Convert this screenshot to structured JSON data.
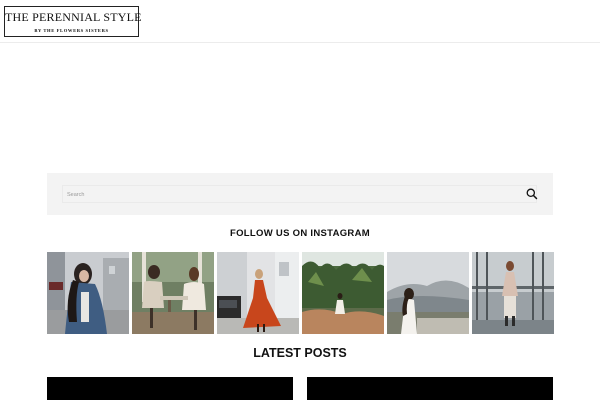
{
  "header": {
    "logo_title": "THE PERENNIAL STYLE",
    "logo_subtitle": "BY THE FLOWERS SISTERS"
  },
  "search": {
    "placeholder": "Search",
    "icon": "search-icon"
  },
  "instagram": {
    "heading": "FOLLOW US ON INSTAGRAM",
    "photos": [
      {
        "icon": "instagram-photo"
      },
      {
        "icon": "instagram-photo"
      },
      {
        "icon": "instagram-photo"
      },
      {
        "icon": "instagram-photo"
      },
      {
        "icon": "instagram-photo"
      },
      {
        "icon": "instagram-photo"
      }
    ]
  },
  "latest": {
    "heading": "LATEST POSTS"
  },
  "colors": {
    "panel": "#f3f3f3",
    "text": "#111111",
    "post_bg": "#000000"
  }
}
